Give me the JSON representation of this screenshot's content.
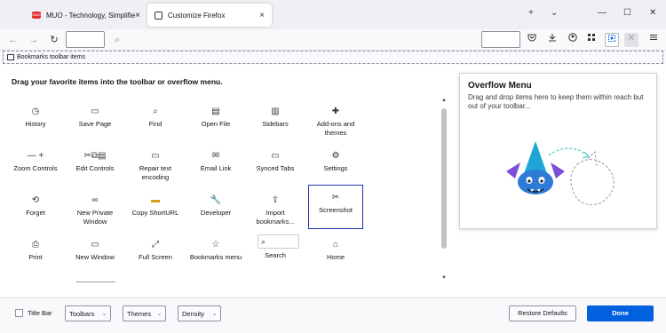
{
  "tabs": [
    {
      "label": "MUO - Technology, Simplified.",
      "favicon": "MUO",
      "close": "×"
    },
    {
      "label": "Customize Firefox",
      "close": "×"
    }
  ],
  "window_controls": {
    "new_tab": "+",
    "list": "⌄",
    "minimize": "—",
    "maximize": "☐",
    "close": "✕"
  },
  "navbar": {
    "back": "←",
    "forward": "→",
    "reload": "↻",
    "search_icon": "⌕"
  },
  "bookmarks_toolbar": {
    "label": "Bookmarks toolbar items"
  },
  "palette": {
    "title": "Drag your favorite items into the toolbar or overflow menu.",
    "items": [
      {
        "label": "History",
        "icon": "◷"
      },
      {
        "label": "Save Page",
        "icon": "▭"
      },
      {
        "label": "Find",
        "icon": "⌕"
      },
      {
        "label": "Open File",
        "icon": "▤"
      },
      {
        "label": "Sidebars",
        "icon": "▥"
      },
      {
        "label": "Add-ons and themes",
        "icon": "✚"
      },
      {
        "label": "Zoom Controls",
        "icon": "— +"
      },
      {
        "label": "Edit Controls",
        "icon": "✂⧉▤"
      },
      {
        "label": "Repair text encoding",
        "icon": "▭"
      },
      {
        "label": "Email Link",
        "icon": "✉"
      },
      {
        "label": "Synced Tabs",
        "icon": "▭"
      },
      {
        "label": "Settings",
        "icon": "⚙"
      },
      {
        "label": "Forget",
        "icon": "⟲"
      },
      {
        "label": "New Private Window",
        "icon": "∞"
      },
      {
        "label": "Copy ShortURL",
        "icon": "▬"
      },
      {
        "label": "Developer",
        "icon": "🔧"
      },
      {
        "label": "Import bookmarks...",
        "icon": "⇪"
      },
      {
        "label": "Screenshot",
        "icon": "✂"
      },
      {
        "label": "Print",
        "icon": "⎙"
      },
      {
        "label": "New Window",
        "icon": "▭"
      },
      {
        "label": "Full Screen",
        "icon": "⤢"
      },
      {
        "label": "Bookmarks menu",
        "icon": "☆"
      },
      {
        "label": "Search",
        "icon": "⌕"
      },
      {
        "label": "Home",
        "icon": "⌂"
      }
    ]
  },
  "overflow_menu": {
    "title": "Overflow Menu",
    "description": "Drag and drop items here to keep them within reach but out of your toolbar..."
  },
  "footer": {
    "title_bar_label": "Title Bar",
    "toolbars_label": "Toolbars",
    "themes_label": "Themes",
    "density_label": "Density",
    "chevron": "⌄",
    "restore_label": "Restore Defaults",
    "done_label": "Done"
  },
  "colors": {
    "accent": "#0060df",
    "highlight_border": "#2233aa",
    "muo_red": "#e03131"
  }
}
